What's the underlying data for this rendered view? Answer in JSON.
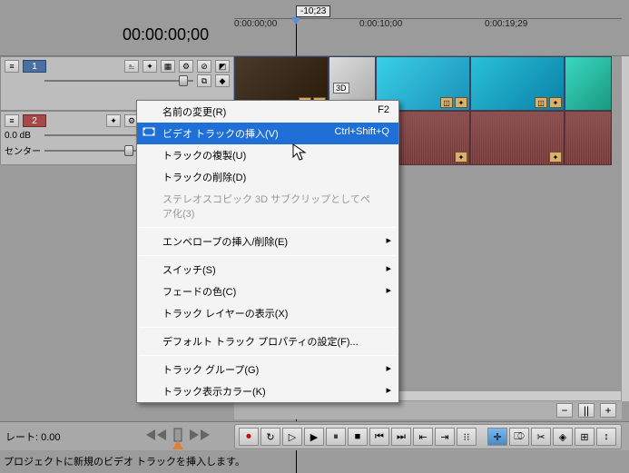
{
  "timecode": "00:00:00;00",
  "marker": {
    "label": "-10;23"
  },
  "ruler": [
    {
      "pos": 0,
      "label": "0:00:00;00"
    },
    {
      "pos": 138,
      "label": "0:00:10;00"
    },
    {
      "pos": 276,
      "label": "0:00:19;29"
    }
  ],
  "tracks": {
    "video": {
      "num": "1",
      "icons": [
        "▥",
        "⎁",
        "✦",
        "▦",
        "⚙",
        "⊘",
        "◩"
      ]
    },
    "audio": {
      "num": "2",
      "db_label": "0.0 dB",
      "center_label": "センター",
      "icons": [
        "▥",
        "✦",
        "⚙",
        "⊘",
        "◩",
        "◉",
        "🔊"
      ]
    }
  },
  "clips": {
    "badge3d": "3D"
  },
  "context_menu": {
    "rename": "名前の変更(R)",
    "rename_shortcut": "F2",
    "insert_video": "ビデオ トラックの挿入(V)",
    "insert_video_shortcut": "Ctrl+Shift+Q",
    "duplicate": "トラックの複製(U)",
    "delete": "トラックの削除(D)",
    "stereo3d": "ステレオスコピック 3D サブクリップとしてペア化(3)",
    "envelope": "エンベロープの挿入/削除(E)",
    "switch": "スイッチ(S)",
    "fade_color": "フェードの色(C)",
    "layer_display": "トラック レイヤーの表示(X)",
    "default_props": "デフォルト トラック プロパティの設定(F)...",
    "track_group": "トラック グループ(G)",
    "track_color": "トラック表示カラー(K)"
  },
  "bottom": {
    "rate_label": "レート:",
    "rate_value": "0.00"
  },
  "transport": {
    "buttons": [
      "⏺",
      "↻",
      "▷",
      "▶",
      "⏸",
      "■",
      "⏮",
      "⏭",
      "⇤",
      "⇥",
      "⁝⁝"
    ],
    "tool_buttons": [
      "✛",
      "⎄",
      "✂",
      "◈",
      "⊞",
      "↕"
    ]
  },
  "status": "プロジェクトに新規のビデオ トラックを挿入します。",
  "zoom": {
    "out": "−",
    "scrub": "||",
    "in": "+"
  }
}
